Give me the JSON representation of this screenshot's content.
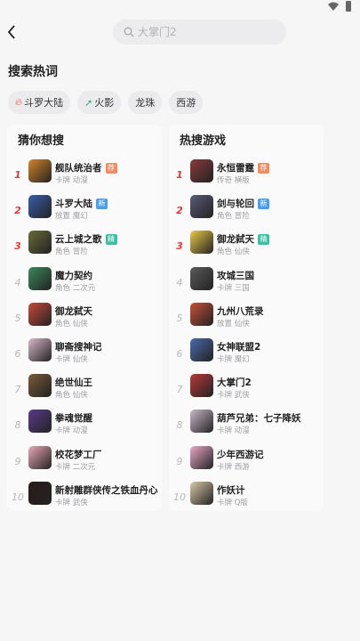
{
  "search": {
    "placeholder": "大掌门2"
  },
  "hot_words": {
    "title": "搜索热词",
    "chips": [
      {
        "label": "斗罗大陆",
        "icon": "fire-icon",
        "icon_color": "#f05a40"
      },
      {
        "label": "火影",
        "icon": "trend-icon",
        "icon_color": "#2eb56b"
      },
      {
        "label": "龙珠"
      },
      {
        "label": "西游"
      }
    ]
  },
  "left_panel": {
    "title": "猜你想搜",
    "items": [
      {
        "rank": "1",
        "name": "舰队统治者",
        "meta": "卡牌 动漫",
        "badge": "荐",
        "badge_type": "hot",
        "icon_color": "#d4862a"
      },
      {
        "rank": "2",
        "name": "斗罗大陆",
        "meta": "放置 魔幻",
        "badge": "新",
        "badge_type": "new",
        "icon_color": "#3a5ea8"
      },
      {
        "rank": "3",
        "name": "云上城之歌",
        "meta": "角色 冒险",
        "badge": "精",
        "badge_type": "fine",
        "icon_color": "#6a6a3a"
      },
      {
        "rank": "4",
        "name": "魔力契约",
        "meta": "角色 二次元",
        "icon_color": "#3a8a5a"
      },
      {
        "rank": "5",
        "name": "御龙弑天",
        "meta": "角色 仙侠",
        "icon_color": "#c84a3a"
      },
      {
        "rank": "6",
        "name": "聊斋搜神记",
        "meta": "卡牌 仙侠",
        "icon_color": "#d8b8c8"
      },
      {
        "rank": "7",
        "name": "绝世仙王",
        "meta": "角色 仙侠",
        "icon_color": "#7a5a3a"
      },
      {
        "rank": "8",
        "name": "拳魂觉醒",
        "meta": "卡牌 动漫",
        "icon_color": "#5a3a8a"
      },
      {
        "rank": "9",
        "name": "校花梦工厂",
        "meta": "卡牌 二次元",
        "icon_color": "#e8a8b8"
      },
      {
        "rank": "10",
        "name": "新射雕群侠传之铁血丹心",
        "meta": "卡牌 武侠",
        "icon_color": "#2a1a1a"
      }
    ]
  },
  "right_panel": {
    "title": "热搜游戏",
    "items": [
      {
        "rank": "1",
        "name": "永恒雷霆",
        "meta": "传奇 横版",
        "badge": "荐",
        "badge_type": "hot",
        "icon_color": "#8a3a3a"
      },
      {
        "rank": "2",
        "name": "剑与轮回",
        "meta": "角色 冒险",
        "badge": "新",
        "badge_type": "new",
        "icon_color": "#5a5a7a"
      },
      {
        "rank": "3",
        "name": "御龙弑天",
        "meta": "角色 仙侠",
        "badge": "精",
        "badge_type": "fine",
        "icon_color": "#e8c84a"
      },
      {
        "rank": "4",
        "name": "攻城三国",
        "meta": "卡牌 三国",
        "icon_color": "#5a5a5a"
      },
      {
        "rank": "5",
        "name": "九州八荒录",
        "meta": "放置 仙侠",
        "icon_color": "#c8503a"
      },
      {
        "rank": "6",
        "name": "女神联盟2",
        "meta": "卡牌 魔幻",
        "icon_color": "#4a6aa8"
      },
      {
        "rank": "7",
        "name": "大掌门2",
        "meta": "卡牌 武侠",
        "icon_color": "#b83a3a"
      },
      {
        "rank": "8",
        "name": "葫芦兄弟：七子降妖",
        "meta": "卡牌 动漫",
        "icon_color": "#c8b8c8"
      },
      {
        "rank": "9",
        "name": "少年西游记",
        "meta": "卡牌 西游",
        "icon_color": "#e8a8c8"
      },
      {
        "rank": "10",
        "name": "作妖计",
        "meta": "卡牌 Q版",
        "icon_color": "#d8c8a8"
      }
    ]
  }
}
